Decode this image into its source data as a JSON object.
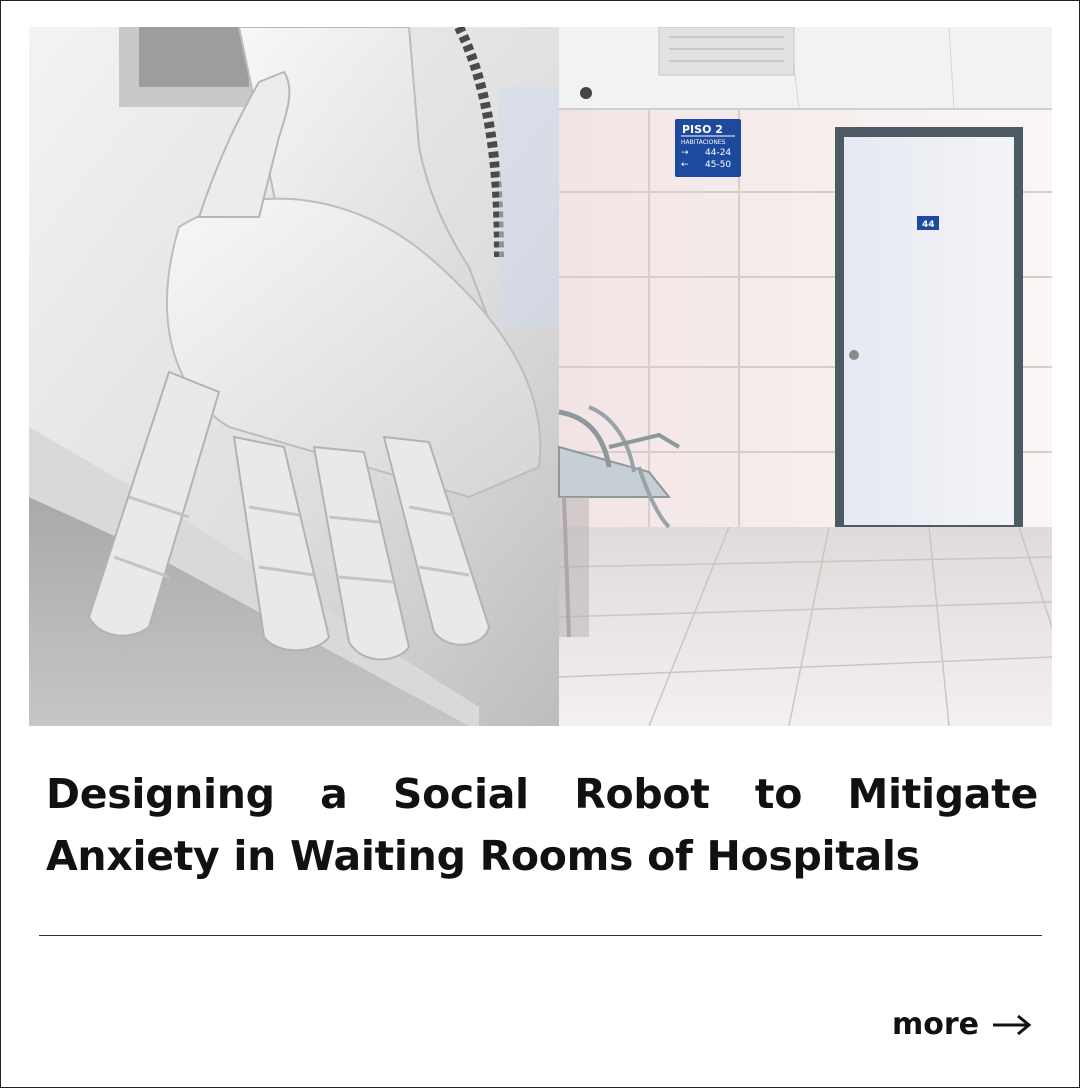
{
  "card": {
    "title": "Designing a Social Robot to Mitigate Anxiety in Waiting Rooms of Hospitals",
    "more_label": "more",
    "more_icon": "arrow-right-icon"
  },
  "hero_image": {
    "sign_title": "PISO  2",
    "sign_subtitle": "HABITACIONES",
    "sign_row_1": "44-24",
    "sign_row_2": "45-50",
    "door_number": "44"
  },
  "colors": {
    "text": "#111111",
    "sign_blue": "#1d4a9c",
    "divider": "#333333"
  }
}
